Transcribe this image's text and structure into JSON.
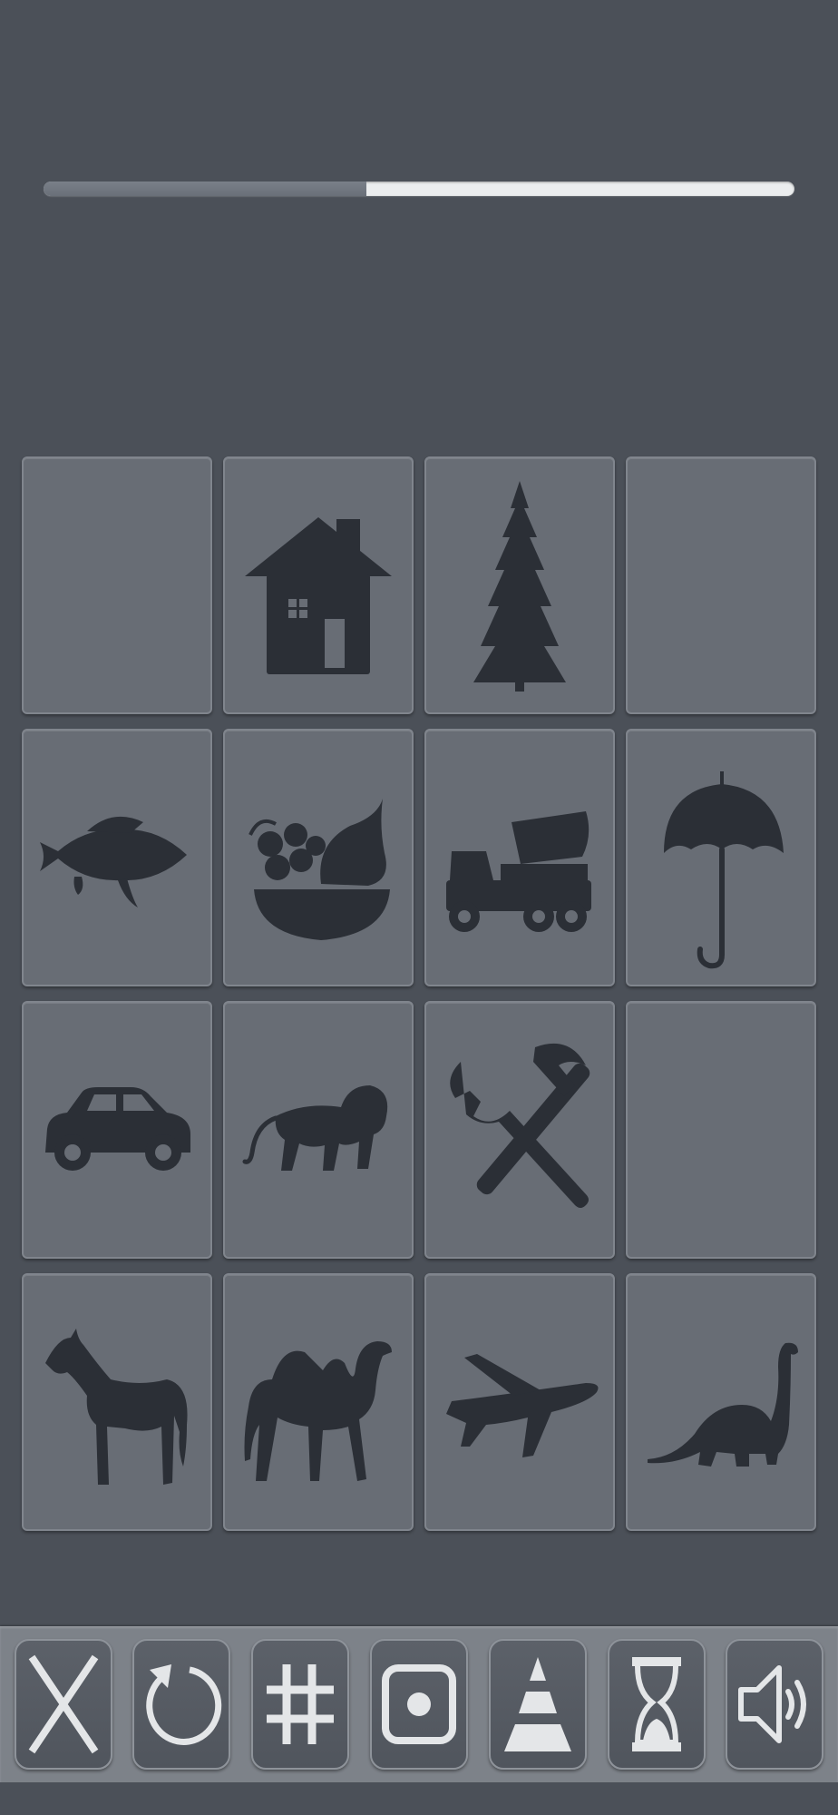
{
  "progress": {
    "fraction": 0.43
  },
  "board": {
    "cards": [
      {
        "icon": "empty"
      },
      {
        "icon": "house-icon"
      },
      {
        "icon": "pine-tree-icon"
      },
      {
        "icon": "empty"
      },
      {
        "icon": "fish-icon"
      },
      {
        "icon": "fruit-bowl-icon"
      },
      {
        "icon": "cement-truck-icon"
      },
      {
        "icon": "umbrella-icon"
      },
      {
        "icon": "car-icon"
      },
      {
        "icon": "lion-icon"
      },
      {
        "icon": "hammer-wrench-icon"
      },
      {
        "icon": "empty"
      },
      {
        "icon": "horse-icon"
      },
      {
        "icon": "camel-icon"
      },
      {
        "icon": "airplane-icon"
      },
      {
        "icon": "dinosaur-icon"
      }
    ]
  },
  "toolbar": {
    "buttons": [
      "close-icon",
      "restart-icon",
      "grid-icon",
      "stop-icon",
      "pyramid-icon",
      "hourglass-icon",
      "speaker-icon"
    ]
  },
  "colors": {
    "background": "#4b5058",
    "card": "#686d75",
    "icon": "#2b2f36",
    "tool_glyph": "#e4e6e8"
  }
}
